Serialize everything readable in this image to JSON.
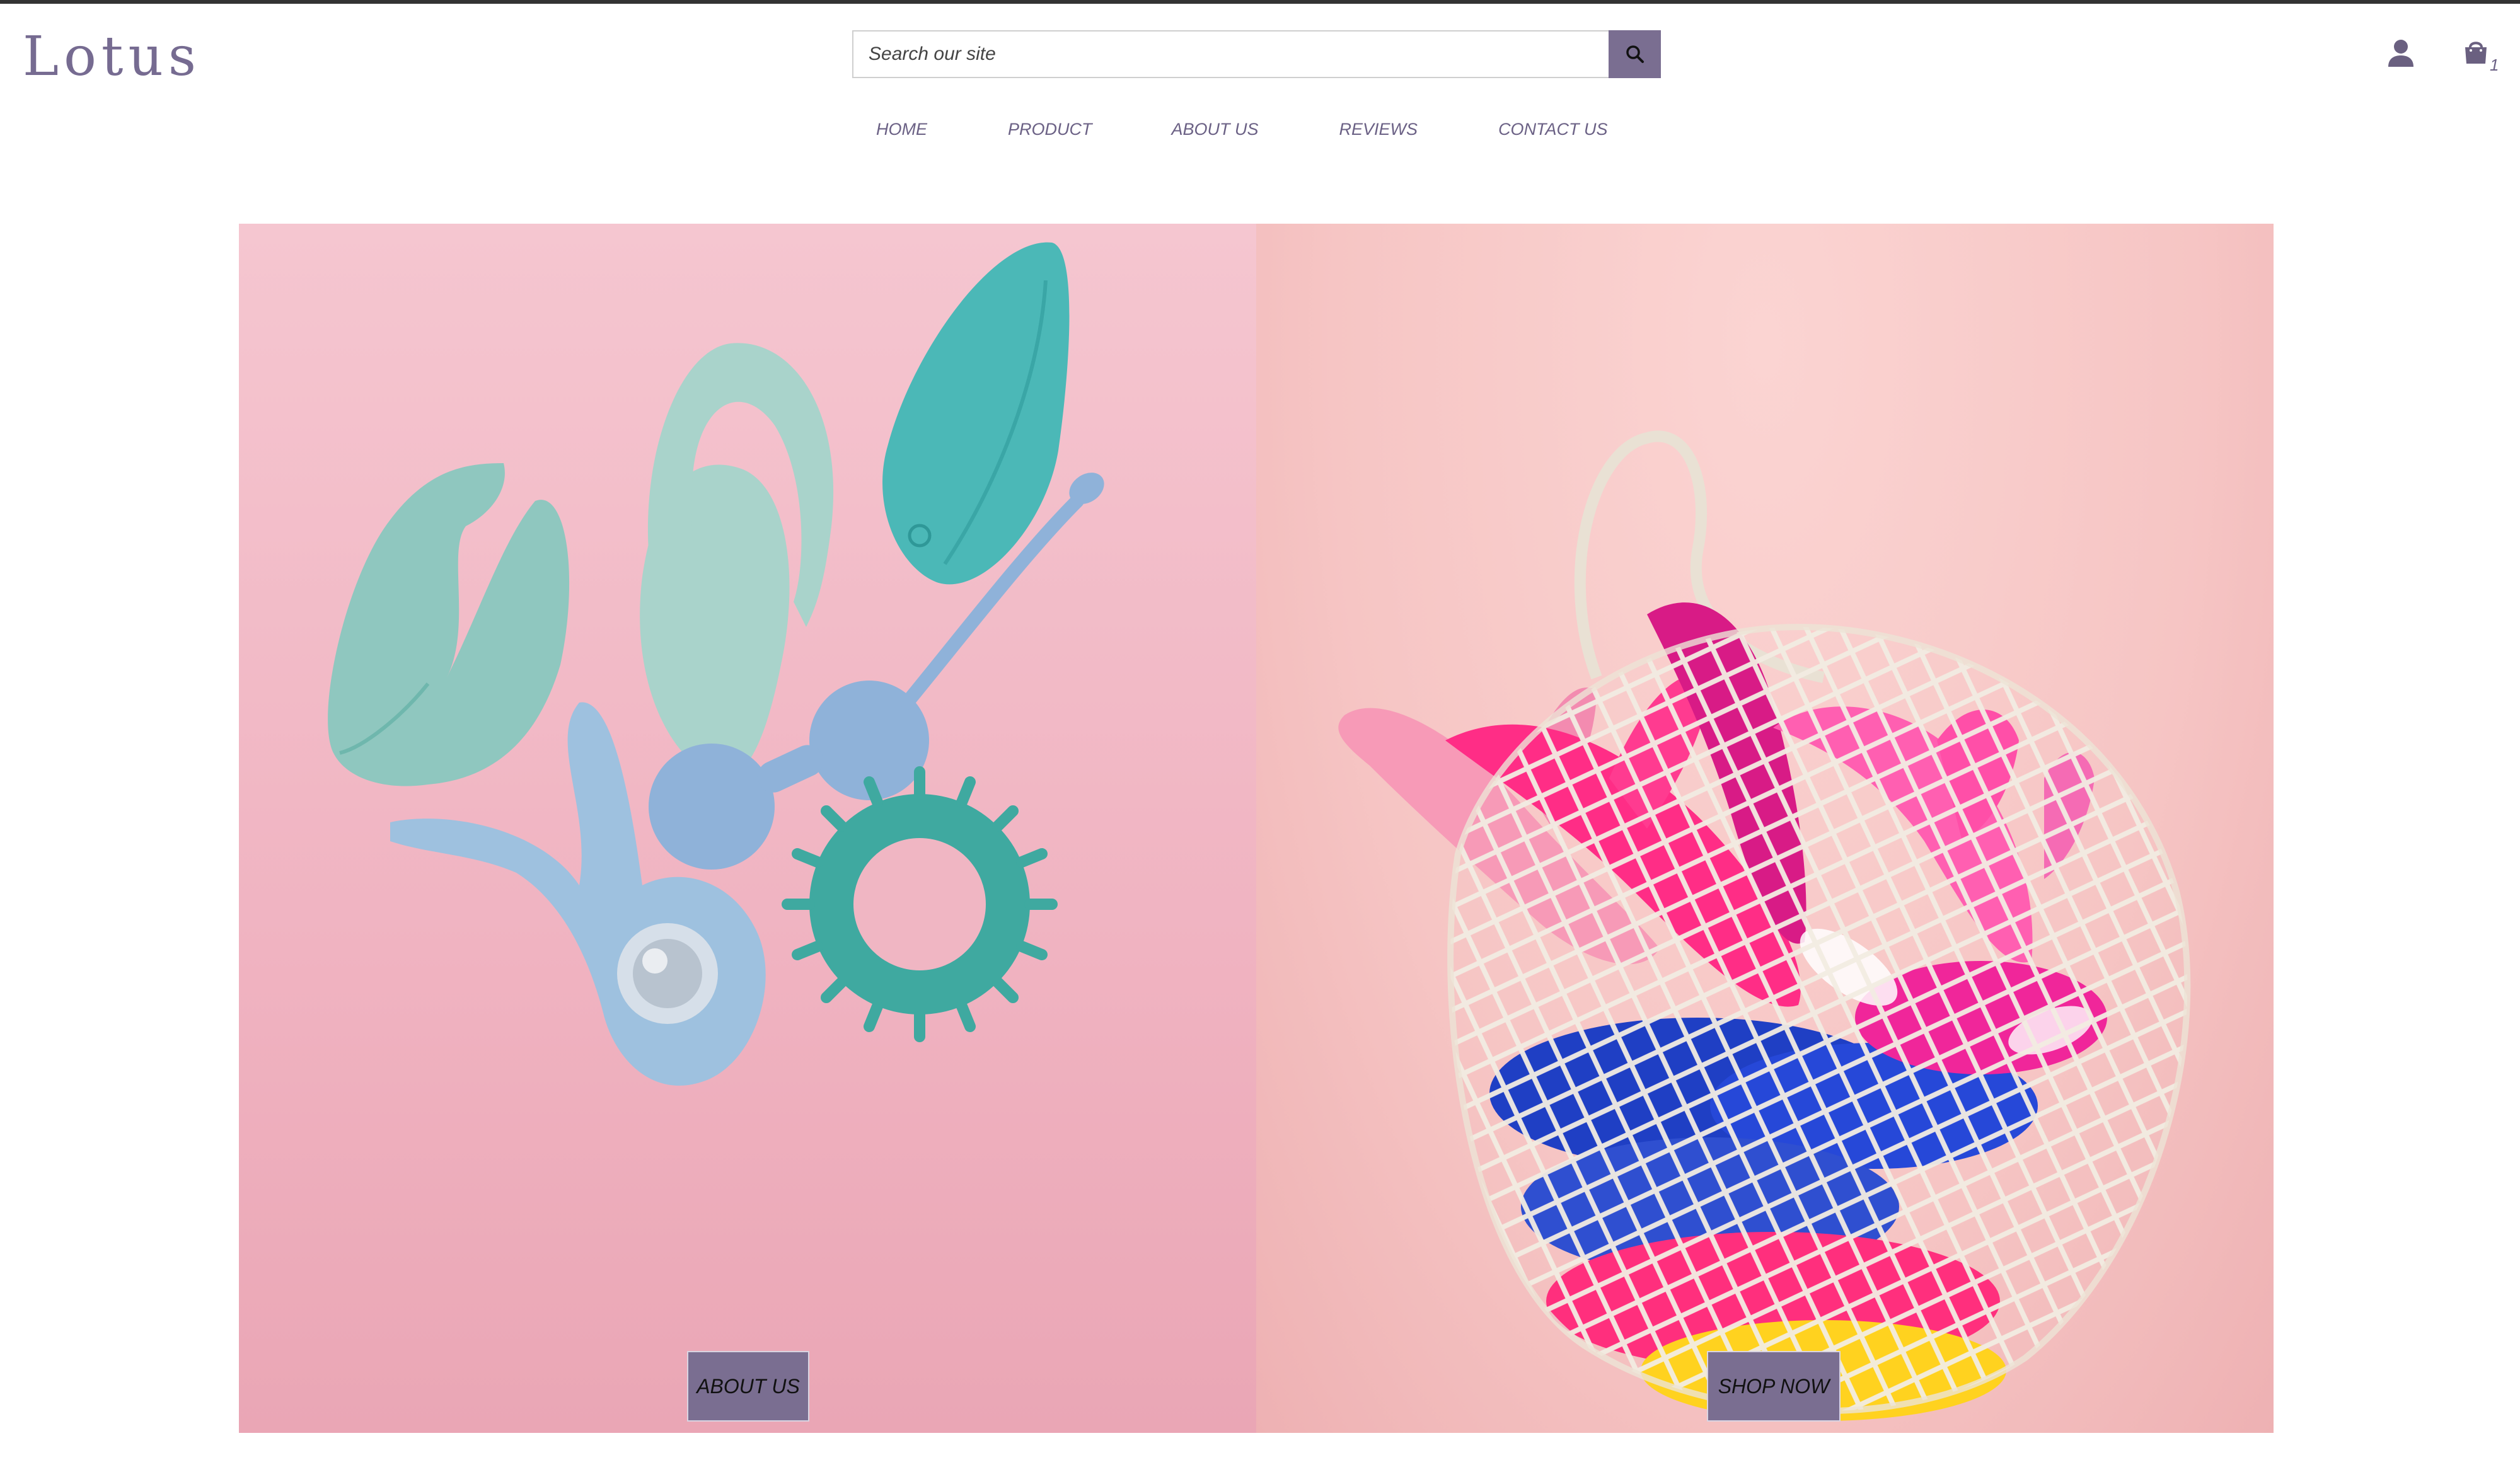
{
  "header": {
    "logo_text": "Lotus",
    "search": {
      "placeholder": "Search our site",
      "value": ""
    },
    "nav": [
      {
        "label": "HOME"
      },
      {
        "label": "PRODUCT"
      },
      {
        "label": "ABOUT US"
      },
      {
        "label": "REVIEWS"
      },
      {
        "label": "CONTACT US"
      }
    ],
    "cart_count": "1",
    "icons": {
      "search": "search-icon",
      "account": "user-icon",
      "cart": "shopping-bag-icon"
    }
  },
  "hero": {
    "left": {
      "image": "pastel-toys-flatlay",
      "button_label": "ABOUT US"
    },
    "right": {
      "image": "net-bag-pink-toys",
      "button_label": "SHOP NOW"
    }
  },
  "colors": {
    "brand": "#766b91",
    "button_bg": "#7a6e91",
    "nav_text": "#6b6185",
    "left_panel_bg": "#f0b3c1",
    "right_panel_bg": "#f6c5c4"
  }
}
